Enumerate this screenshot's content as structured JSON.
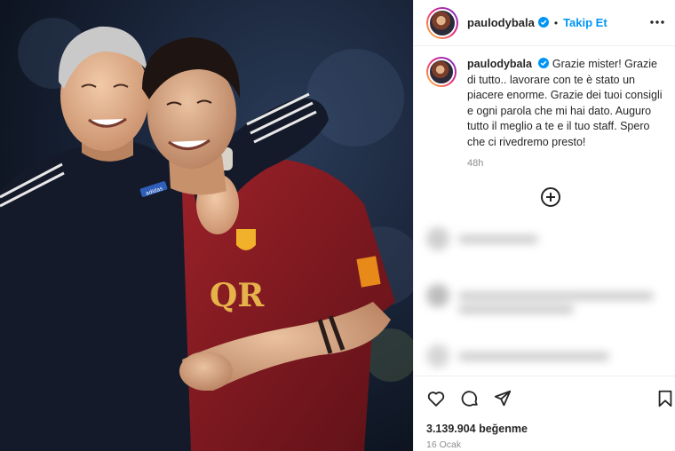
{
  "post": {
    "username": "paulodybala",
    "follow_label": "Takip Et",
    "separator": "•",
    "caption_text": "Grazie mister! Grazie di tutto.. lavorare con te è stato un piacere enorme. Grazie dei tuoi consigli e ogni parola che mi hai dato. Auguro tutto il meglio a te e il tuo staff. Spero che ci rivedremo presto!",
    "caption_time": "48h",
    "likes_text": "3.139.904 beğenme",
    "date_text": "16 Ocak",
    "photo_text": {
      "kit_sponsor": "QR",
      "jacket_badge": "adidas"
    }
  },
  "icons": {
    "verified": "verified-badge-icon",
    "more": "more-options-icon",
    "add_comment": "plus-circle-icon",
    "like": "heart-icon",
    "comment": "comment-icon",
    "share": "share-icon",
    "save": "bookmark-icon"
  },
  "colors": {
    "accent": "#0095f6",
    "text": "#262626",
    "muted": "#8e8e8e",
    "jersey": "#8a1c22",
    "armband": "#e88a1a"
  }
}
